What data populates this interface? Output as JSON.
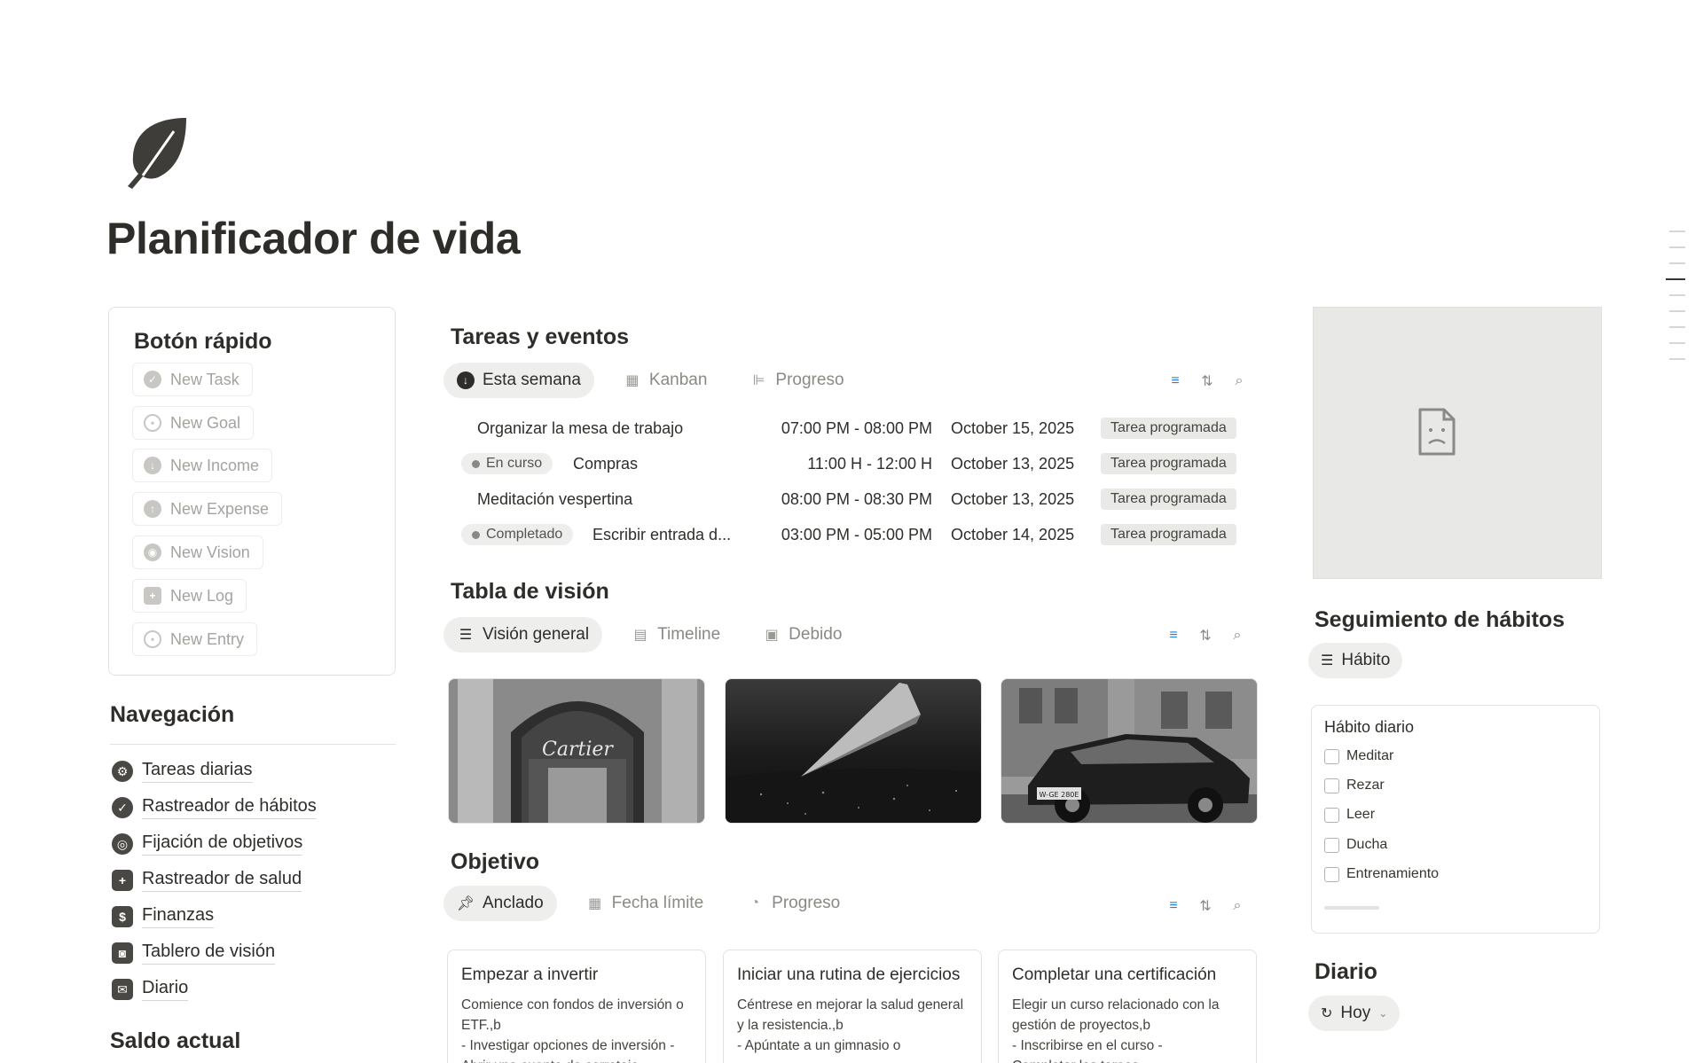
{
  "page": {
    "title": "Planificador de vida",
    "icon": "leaf-icon"
  },
  "quick": {
    "title": "Botón rápido",
    "buttons": [
      {
        "label": "New Task",
        "icon": "check-circle-icon"
      },
      {
        "label": "New Goal",
        "icon": "target-icon"
      },
      {
        "label": "New Income",
        "icon": "arrow-down-circle-icon"
      },
      {
        "label": "New Expense",
        "icon": "arrow-up-circle-icon"
      },
      {
        "label": "New Vision",
        "icon": "eye-icon"
      },
      {
        "label": "New Log",
        "icon": "medical-kit-icon"
      },
      {
        "label": "New Entry",
        "icon": "target-icon"
      }
    ]
  },
  "nav": {
    "title": "Navegación",
    "items": [
      {
        "label": "Tareas diarias",
        "icon": "gears-icon"
      },
      {
        "label": "Rastreador de hábitos",
        "icon": "check-circle-icon"
      },
      {
        "label": "Fijación de objetivos",
        "icon": "target-icon"
      },
      {
        "label": "Rastreador de salud",
        "icon": "medical-kit-icon"
      },
      {
        "label": "Finanzas",
        "icon": "money-icon"
      },
      {
        "label": "Tablero de visión",
        "icon": "camera-icon"
      },
      {
        "label": "Diario",
        "icon": "inbox-icon"
      }
    ]
  },
  "saldo": {
    "title": "Saldo actual"
  },
  "tasks": {
    "title": "Tareas y eventos",
    "tabs": [
      {
        "label": "Esta semana",
        "icon": "arrow-down-circle-icon"
      },
      {
        "label": "Kanban",
        "icon": "calendar-icon"
      },
      {
        "label": "Progreso",
        "icon": "gantt-icon"
      }
    ],
    "rows": [
      {
        "status": "",
        "name": "Organizar la mesa de trabajo",
        "time": "07:00 PM - 08:00 PM",
        "date": "October 15, 2025",
        "tag": "Tarea programada"
      },
      {
        "status": "En curso",
        "name": "Compras",
        "time": "11:00 H - 12:00 H",
        "date": "October 13, 2025",
        "tag": "Tarea programada"
      },
      {
        "status": "",
        "name": "Meditación vespertina",
        "time": "08:00 PM - 08:30 PM",
        "date": "October 13, 2025",
        "tag": "Tarea programada"
      },
      {
        "status": "Completado",
        "name": "Escribir entrada d...",
        "time": "03:00 PM - 05:00 PM",
        "date": "October 14, 2025",
        "tag": "Tarea programada"
      }
    ]
  },
  "vision": {
    "title": "Tabla de visión",
    "tabs": [
      {
        "label": "Visión general",
        "icon": "stack-icon"
      },
      {
        "label": "Timeline",
        "icon": "timeline-icon"
      },
      {
        "label": "Debido",
        "icon": "calendar-icon"
      }
    ],
    "images": [
      {
        "name": "cartier-store-photo",
        "sign": "Cartier"
      },
      {
        "name": "airplane-wing-photo"
      },
      {
        "name": "classic-car-photo",
        "plate": "W-GE 280E"
      }
    ]
  },
  "goals": {
    "title": "Objetivo",
    "tabs": [
      {
        "label": "Anclado",
        "icon": "pin-icon"
      },
      {
        "label": "Fecha límite",
        "icon": "calendar-icon"
      },
      {
        "label": "Progreso",
        "icon": "pie-icon"
      }
    ],
    "cards": [
      {
        "title": "Empezar a invertir",
        "desc": "Comience con fondos de inversión o ETF.,b\n- Investigar opciones de inversión -\nAbrir una cuenta de corretaje"
      },
      {
        "title": "Iniciar una rutina de ejercicios",
        "desc": "Céntrese en mejorar la salud general y la resistencia.,b\n- Apúntate a un gimnasio o"
      },
      {
        "title": "Completar una certificación",
        "desc": "Elegir un curso relacionado con la gestión de proyectos,b\n- Inscribirse en el curso -\nCompletar las tareas"
      }
    ]
  },
  "habits": {
    "title": "Seguimiento de hábitos",
    "tab": {
      "label": "Hábito",
      "icon": "stack-icon"
    },
    "box_title": "Hábito diario",
    "items": [
      "Meditar",
      "Rezar",
      "Leer",
      "Ducha",
      "Entrenamiento"
    ]
  },
  "diario": {
    "title": "Diario",
    "button": {
      "label": "Hoy",
      "icon": "refresh-icon"
    }
  }
}
